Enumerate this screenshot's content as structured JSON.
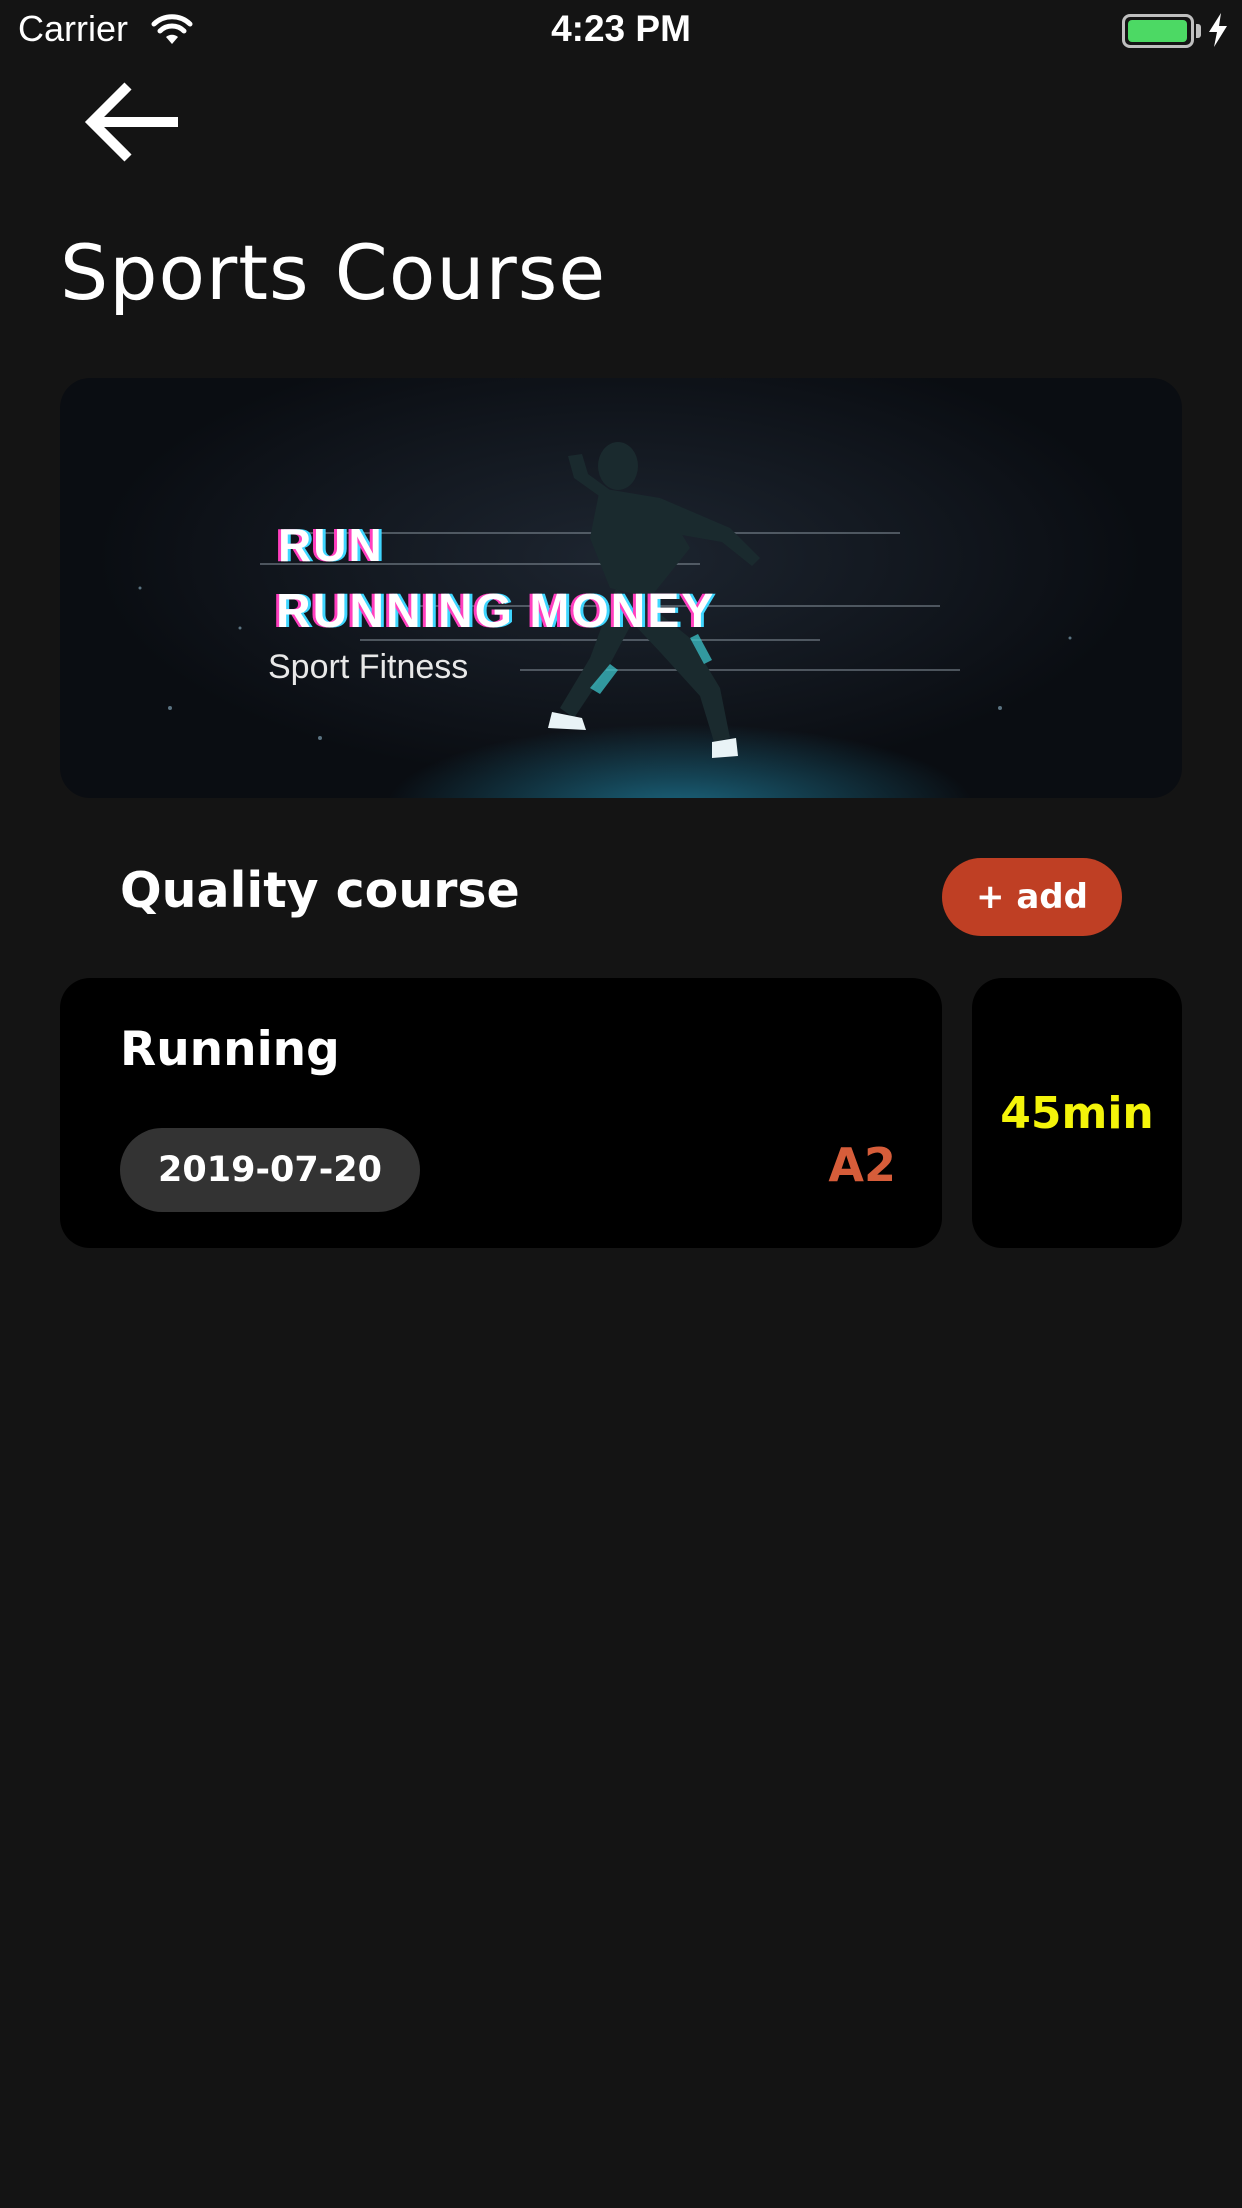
{
  "status_bar": {
    "carrier": "Carrier",
    "time": "4:23 PM",
    "battery_level": 0.9,
    "battery_color": "#4cd964",
    "charging": true
  },
  "header": {
    "back_icon": "arrow-left-icon",
    "title": "Sports Course"
  },
  "banner": {
    "line1": "RUN",
    "line2": "RUNNING MONEY",
    "line3": "Sport Fitness"
  },
  "section": {
    "title": "Quality course",
    "add_label": "+ add",
    "add_color": "#bf3f24"
  },
  "course": {
    "name": "Running",
    "date": "2019-07-20",
    "level": "A2",
    "level_color": "#d65d3a",
    "duration": "45min",
    "duration_color": "#f4f40a"
  }
}
